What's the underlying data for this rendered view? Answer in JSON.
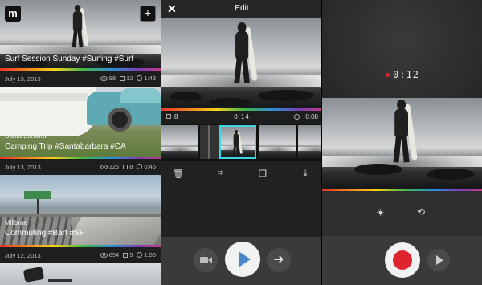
{
  "feed": {
    "cards": [
      {
        "location": "",
        "title": "Surf Session Sunday #Surfing #Surf",
        "date": "July 13, 2013",
        "views": "98",
        "clips": "12",
        "duration": "1:43"
      },
      {
        "location": "Santa Barbara",
        "title": "Camping Trip #Santabarbara #CA",
        "date": "July 13, 2013",
        "views": "325",
        "clips": "8",
        "duration": "0:45"
      },
      {
        "location": "Millbrae",
        "title": "Commuting #Bart #SF",
        "date": "July 12, 2013",
        "views": "654",
        "clips": "5",
        "duration": "1:56"
      }
    ],
    "logo": "m"
  },
  "edit": {
    "title": "Edit",
    "clip_count": "8",
    "current_time": "0:14",
    "total_time": "0:08"
  },
  "record": {
    "timer": "0:12"
  },
  "icons": {
    "close": "close-icon",
    "trash": "trash-icon",
    "crop": "crop-icon",
    "copy": "copy-icon",
    "download": "download-icon",
    "camera": "video-camera-icon",
    "play": "play-icon",
    "next": "arrow-right-icon",
    "brightness": "brightness-icon",
    "flip": "flip-camera-icon"
  },
  "colors": {
    "accent": "#3fd3e6",
    "record": "#e0242d",
    "play": "#4a86c8"
  }
}
